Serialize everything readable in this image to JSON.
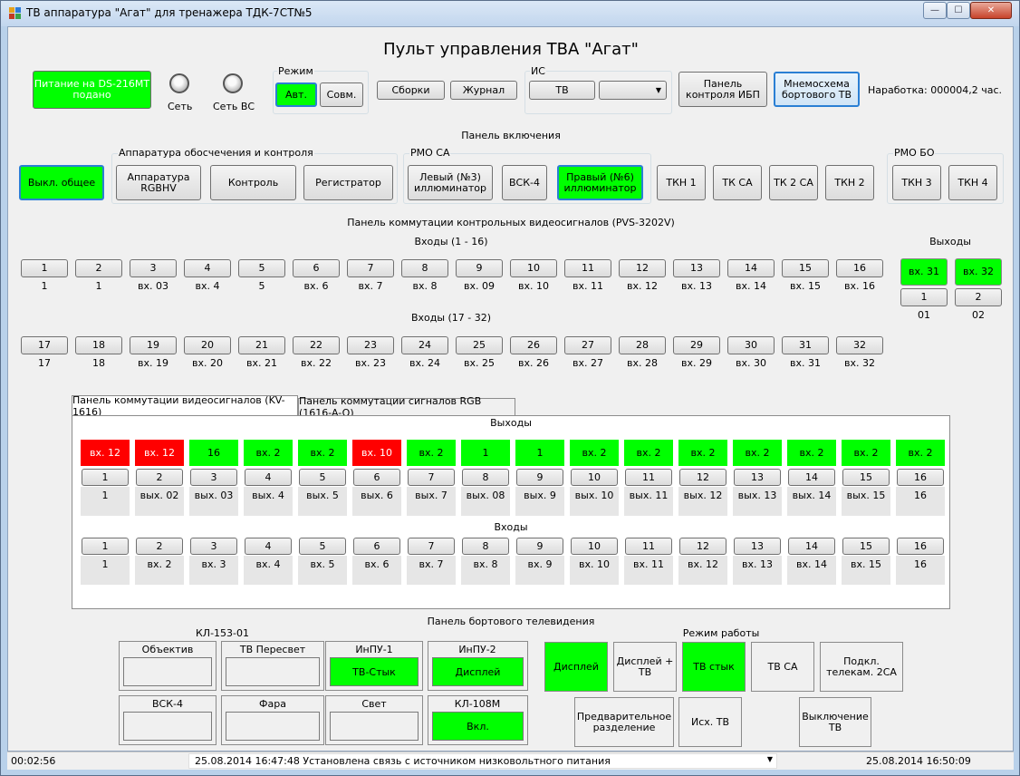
{
  "window": {
    "title": "ТВ аппаратура \"Агат\" для тренажера ТДК-7СТ№5",
    "min": "—",
    "max": "☐",
    "close": "✕"
  },
  "header": {
    "title": "Пульт управления ТВА \"Агат\"",
    "power_status": "Питание на DS-216MT подано",
    "lamp_net": "Сеть",
    "lamp_net_vs": "Сеть ВС",
    "mode_group": "Режим",
    "mode_auto": "Авт.",
    "mode_sovm": "Совм.",
    "btn_sborki": "Сборки",
    "btn_journal": "Журнал",
    "is_group": "ИС",
    "is_tv": "ТВ",
    "is_select_value": "",
    "btn_ibp": "Панель контроля ИБП",
    "btn_mnemo": "Мнемосхема бортового ТВ",
    "runtime": "Наработка: 000004,2 час."
  },
  "power_panel": {
    "title": "Панель включения",
    "btn_off_all": "Выкл. общее",
    "group_apparatus": "Аппаратура обосчечения и контроля",
    "btn_rgbhv": "Аппаратура RGBHV",
    "btn_control": "Контроль",
    "btn_registrator": "Регистратор",
    "group_rmo_ca": "РМО СА",
    "btn_left_ill": "Левый (№3) иллюминатор",
    "btn_vsk4": "ВСК-4",
    "btn_right_ill": "Правый (№6) иллюминатор",
    "btn_tkn1": "ТКН 1",
    "btn_tkca": "ТК СА",
    "btn_tk2ca": "ТК 2 СА",
    "btn_tkn2": "ТКН 2",
    "group_rmo_bo": "РМО БО",
    "btn_tkn3": "ТКН 3",
    "btn_tkn4": "ТКН 4"
  },
  "pvs": {
    "title": "Панель коммутации контрольных видеосигналов (PVS-3202V)",
    "inputs1_title": "Входы (1 - 16)",
    "inputs2_title": "Входы (17 - 32)",
    "outputs_title": "Выходы",
    "row1": [
      {
        "btn": "1",
        "cap": "1"
      },
      {
        "btn": "2",
        "cap": "1"
      },
      {
        "btn": "3",
        "cap": "вх. 03"
      },
      {
        "btn": "4",
        "cap": "вх. 4"
      },
      {
        "btn": "5",
        "cap": "5"
      },
      {
        "btn": "6",
        "cap": "вх. 6"
      },
      {
        "btn": "7",
        "cap": "вх. 7"
      },
      {
        "btn": "8",
        "cap": "вх. 8"
      },
      {
        "btn": "9",
        "cap": "вх. 09"
      },
      {
        "btn": "10",
        "cap": "вх. 10"
      },
      {
        "btn": "11",
        "cap": "вх. 11"
      },
      {
        "btn": "12",
        "cap": "вх. 12"
      },
      {
        "btn": "13",
        "cap": "вх. 13"
      },
      {
        "btn": "14",
        "cap": "вх. 14"
      },
      {
        "btn": "15",
        "cap": "вх. 15"
      },
      {
        "btn": "16",
        "cap": "вх. 16"
      }
    ],
    "row2": [
      {
        "btn": "17",
        "cap": "17"
      },
      {
        "btn": "18",
        "cap": "18"
      },
      {
        "btn": "19",
        "cap": "вх. 19"
      },
      {
        "btn": "20",
        "cap": "вх. 20"
      },
      {
        "btn": "21",
        "cap": "вх. 21"
      },
      {
        "btn": "22",
        "cap": "вх. 22"
      },
      {
        "btn": "23",
        "cap": "вх. 23"
      },
      {
        "btn": "24",
        "cap": "вх. 24"
      },
      {
        "btn": "25",
        "cap": "вх. 25"
      },
      {
        "btn": "26",
        "cap": "вх. 26"
      },
      {
        "btn": "27",
        "cap": "вх. 27"
      },
      {
        "btn": "28",
        "cap": "вх. 28"
      },
      {
        "btn": "29",
        "cap": "вх. 29"
      },
      {
        "btn": "30",
        "cap": "вх. 30"
      },
      {
        "btn": "31",
        "cap": "вх. 31"
      },
      {
        "btn": "32",
        "cap": "вх. 32"
      }
    ],
    "outputs": [
      {
        "status": "вх. 31",
        "btn": "1",
        "cap": "01"
      },
      {
        "status": "вх. 32",
        "btn": "2",
        "cap": "02"
      }
    ]
  },
  "tabs": {
    "tab1": "Панель коммутации видеосигналов (KV-1616)",
    "tab2": "Панель коммутации сигналов RGB (1616-A-Q)",
    "outputs_title": "Выходы",
    "inputs_title": "Входы",
    "outputs": [
      {
        "status": "вх. 12",
        "color": "red",
        "btn": "1",
        "cap": "1"
      },
      {
        "status": "вх. 12",
        "color": "red",
        "btn": "2",
        "cap": "вых. 02"
      },
      {
        "status": "16",
        "color": "green",
        "btn": "3",
        "cap": "вых. 03"
      },
      {
        "status": "вх. 2",
        "color": "green",
        "btn": "4",
        "cap": "вых. 4"
      },
      {
        "status": "вх. 2",
        "color": "green",
        "btn": "5",
        "cap": "вых. 5"
      },
      {
        "status": "вх. 10",
        "color": "red",
        "btn": "6",
        "cap": "вых. 6"
      },
      {
        "status": "вх. 2",
        "color": "green",
        "btn": "7",
        "cap": "вых. 7"
      },
      {
        "status": "1",
        "color": "green",
        "btn": "8",
        "cap": "вых. 08"
      },
      {
        "status": "1",
        "color": "green",
        "btn": "9",
        "cap": "вых. 9"
      },
      {
        "status": "вх. 2",
        "color": "green",
        "btn": "10",
        "cap": "вых. 10"
      },
      {
        "status": "вх. 2",
        "color": "green",
        "btn": "11",
        "cap": "вых. 11"
      },
      {
        "status": "вх. 2",
        "color": "green",
        "btn": "12",
        "cap": "вых. 12"
      },
      {
        "status": "вх. 2",
        "color": "green",
        "btn": "13",
        "cap": "вых. 13"
      },
      {
        "status": "вх. 2",
        "color": "green",
        "btn": "14",
        "cap": "вых. 14"
      },
      {
        "status": "вх. 2",
        "color": "green",
        "btn": "15",
        "cap": "вых. 15"
      },
      {
        "status": "вх. 2",
        "color": "green",
        "btn": "16",
        "cap": "16"
      }
    ],
    "inputs": [
      {
        "btn": "1",
        "cap": "1"
      },
      {
        "btn": "2",
        "cap": "вх. 2"
      },
      {
        "btn": "3",
        "cap": "вх. 3"
      },
      {
        "btn": "4",
        "cap": "вх. 4"
      },
      {
        "btn": "5",
        "cap": "вх. 5"
      },
      {
        "btn": "6",
        "cap": "вх. 6"
      },
      {
        "btn": "7",
        "cap": "вх. 7"
      },
      {
        "btn": "8",
        "cap": "вх. 8"
      },
      {
        "btn": "9",
        "cap": "вх. 9"
      },
      {
        "btn": "10",
        "cap": "вх. 10"
      },
      {
        "btn": "11",
        "cap": "вх. 11"
      },
      {
        "btn": "12",
        "cap": "вх. 12"
      },
      {
        "btn": "13",
        "cap": "вх. 13"
      },
      {
        "btn": "14",
        "cap": "вх. 14"
      },
      {
        "btn": "15",
        "cap": "вх. 15"
      },
      {
        "btn": "16",
        "cap": "16"
      }
    ]
  },
  "board_tv": {
    "title": "Панель бортового телевидения",
    "kl153": "КЛ-153-01",
    "objective": "Объектив",
    "tv_peresvet": "ТВ Пересвет",
    "inpu1": "ИнПУ-1",
    "inpu1_value": "ТВ-Стык",
    "inpu2": "ИнПУ-2",
    "inpu2_value": "Дисплей",
    "vsk4": "ВСК-4",
    "fara": "Фара",
    "svet": "Свет",
    "kl108": "КЛ-108М",
    "kl108_value": "Вкл.",
    "mode_title": "Режим работы",
    "btn_display": "Дисплей",
    "btn_display_tv": "Дисплей + ТВ",
    "btn_tv_styk": "ТВ стык",
    "btn_tv_ca": "ТВ СА",
    "btn_telecam": "Подкл. телекам. 2СА",
    "btn_pre_sep": "Предварительное разделение",
    "btn_isx_tv": "Исх. ТВ",
    "btn_tv_off": "Выключение ТВ"
  },
  "statusbar": {
    "elapsed": "00:02:56",
    "message": "25.08.2014 16:47:48 Установлена связь с источником низковольтного питания",
    "datetime": "25.08.2014 16:50:09"
  },
  "colors": {
    "on": "#00ff00",
    "alarm": "#ff0000",
    "accent": "#2a7fd4"
  }
}
